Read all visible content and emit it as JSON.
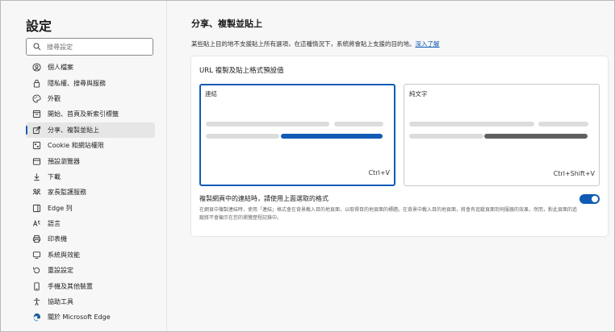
{
  "sidebar": {
    "title": "設定",
    "search_placeholder": "搜尋設定",
    "items": [
      {
        "label": "個人檔案",
        "icon": "profile-icon"
      },
      {
        "label": "隱私權、搜尋與服務",
        "icon": "lock-icon"
      },
      {
        "label": "外觀",
        "icon": "palette-icon"
      },
      {
        "label": "開始、首頁及新索引標籤",
        "icon": "home-tabs-icon"
      },
      {
        "label": "分享、複製並貼上",
        "icon": "share-icon",
        "active": true
      },
      {
        "label": "Cookie 和網站權限",
        "icon": "cookie-icon"
      },
      {
        "label": "預設瀏覽器",
        "icon": "browser-icon"
      },
      {
        "label": "下載",
        "icon": "download-icon"
      },
      {
        "label": "家長監護服務",
        "icon": "family-icon"
      },
      {
        "label": "Edge 列",
        "icon": "edge-bar-icon"
      },
      {
        "label": "語言",
        "icon": "language-icon"
      },
      {
        "label": "印表機",
        "icon": "printer-icon"
      },
      {
        "label": "系統與效能",
        "icon": "system-icon"
      },
      {
        "label": "重設設定",
        "icon": "reset-icon"
      },
      {
        "label": "手機及其他裝置",
        "icon": "phone-icon"
      },
      {
        "label": "協助工具",
        "icon": "accessibility-icon"
      },
      {
        "label": "關於 Microsoft Edge",
        "icon": "edge-logo-icon"
      }
    ]
  },
  "main": {
    "title": "分享、複製並貼上",
    "description": "某些貼上目的地不支援貼上所有選項，在這種情況下，系統將會貼上支援的目的地。",
    "learn_more": "深入了解",
    "card": {
      "title": "URL 複製及貼上格式預設值",
      "options": [
        {
          "label": "連結",
          "shortcut": "Ctrl+V",
          "selected": true
        },
        {
          "label": "純文字",
          "shortcut": "Ctrl+Shift+V",
          "selected": false
        }
      ],
      "toggle_title": "複製網頁中的連結時，請使用上面選取的格式",
      "toggle_desc": "在網頁中複製連結時，使用「連結」格式會在背景載入目的地頁面，以取得目的地頁面的標題。在背景中載入目的地頁面，將會有追蹤頁面到伺服器的效果，然而，對此頁面的追蹤將不會顯示在您的瀏覽歷程記錄中。",
      "toggle_on": true
    }
  },
  "colors": {
    "accent": "#0f5bb5",
    "bar_gray": "#dcdcdc",
    "bar_dark": "#606060"
  }
}
